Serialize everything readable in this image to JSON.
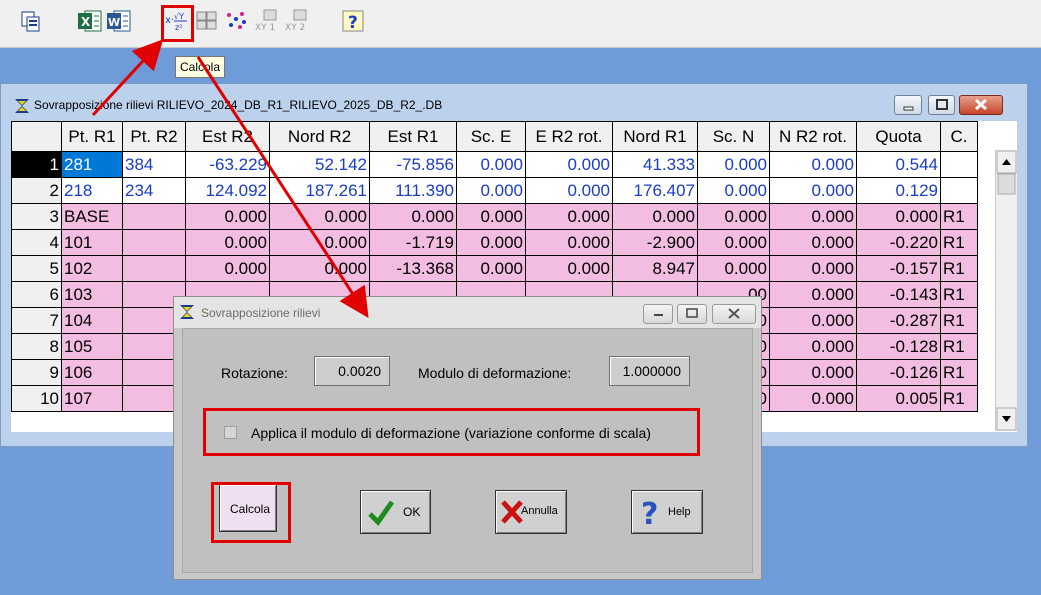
{
  "toolbar": {
    "buttons": [
      "copy-icon",
      "excel-icon",
      "word-icon",
      "calcola-icon",
      "table-icon-1",
      "scatter-icon",
      "xy1-icon",
      "xy2-icon",
      "help-icon"
    ],
    "xy1_label": "XY 1",
    "xy2_label": "XY 2",
    "help_label": "?"
  },
  "tooltip": "Calcola",
  "grid_window": {
    "title": "Sovrapposizione rilievi RILIEVO_2024_DB_R1_RILIEVO_2025_DB_R2_.DB",
    "columns": [
      "",
      "Pt. R1",
      "Pt. R2",
      "Est R2",
      "Nord R2",
      "Est R1",
      "Sc. E",
      "E R2 rot.",
      "Nord R1",
      "Sc. N",
      "N R2 rot.",
      "Quota",
      "C."
    ],
    "rows": [
      [
        "1",
        "281",
        "384",
        "-63.229",
        "52.142",
        "-75.856",
        "0.000",
        "0.000",
        "41.333",
        "0.000",
        "0.000",
        "0.544",
        ""
      ],
      [
        "2",
        "218",
        "234",
        "124.092",
        "187.261",
        "111.390",
        "0.000",
        "0.000",
        "176.407",
        "0.000",
        "0.000",
        "0.129",
        ""
      ],
      [
        "3",
        "BASE",
        "",
        "0.000",
        "0.000",
        "0.000",
        "0.000",
        "0.000",
        "0.000",
        "0.000",
        "0.000",
        "0.000",
        "R1"
      ],
      [
        "4",
        "101",
        "",
        "0.000",
        "0.000",
        "-1.719",
        "0.000",
        "0.000",
        "-2.900",
        "0.000",
        "0.000",
        "-0.220",
        "R1"
      ],
      [
        "5",
        "102",
        "",
        "0.000",
        "0.000",
        "-13.368",
        "0.000",
        "0.000",
        "8.947",
        "0.000",
        "0.000",
        "-0.157",
        "R1"
      ],
      [
        "6",
        "103",
        "",
        "",
        "",
        "",
        "",
        "",
        "",
        "00",
        "0.000",
        "-0.143",
        "R1"
      ],
      [
        "7",
        "104",
        "",
        "",
        "",
        "",
        "",
        "",
        "",
        "00",
        "0.000",
        "-0.287",
        "R1"
      ],
      [
        "8",
        "105",
        "",
        "",
        "",
        "",
        "",
        "",
        "",
        "00",
        "0.000",
        "-0.128",
        "R1"
      ],
      [
        "9",
        "106",
        "",
        "",
        "",
        "",
        "",
        "",
        "",
        "00",
        "0.000",
        "-0.126",
        "R1"
      ],
      [
        "10",
        "107",
        "",
        "",
        "",
        "",
        "",
        "",
        "",
        "00",
        "0.000",
        "0.005",
        "R1"
      ]
    ]
  },
  "dialog": {
    "title": "Sovrapposizione rilievi",
    "rotazione_label": "Rotazione:",
    "rotazione_value": "0.0020",
    "modulo_label": "Modulo di deformazione:",
    "modulo_value": "1.000000",
    "checkbox_label": "Applica il modulo di deformazione (variazione conforme di scala)",
    "checkbox_checked": false,
    "calcola_label": "Calcola",
    "ok_label": "OK",
    "annulla_label": "Annulla",
    "help_label": "Help"
  },
  "colors": {
    "highlight": "#e00000",
    "pink_row": "#f2bde0",
    "blue_text": "#1a3cc6",
    "desktop": "#6f9bd9"
  }
}
